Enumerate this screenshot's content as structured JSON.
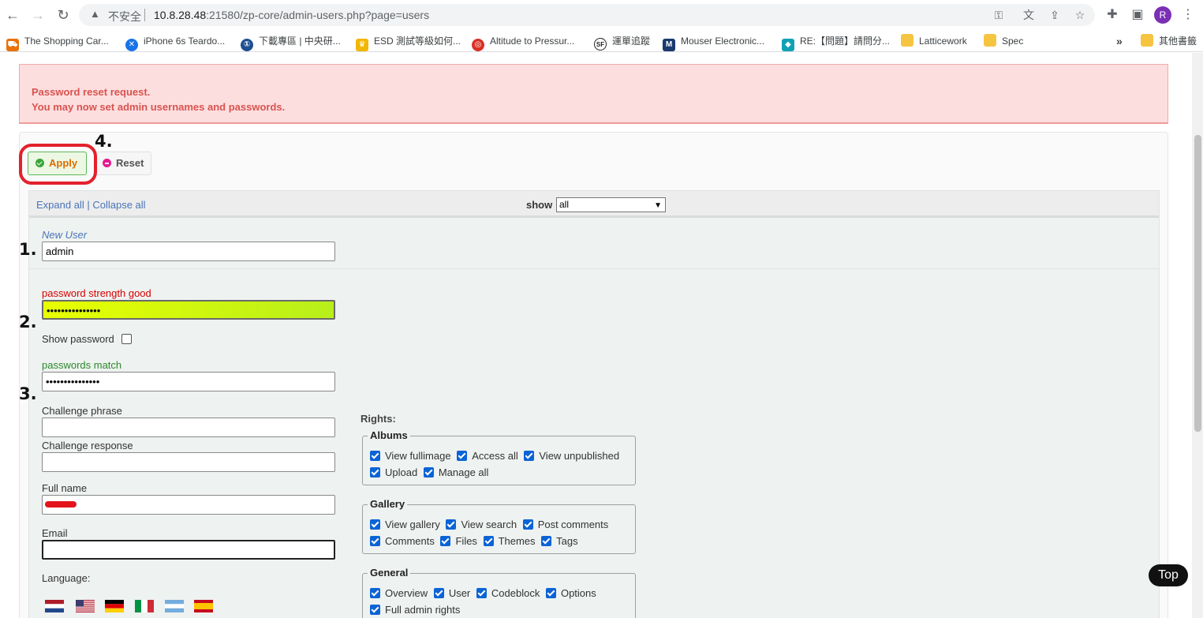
{
  "browser": {
    "insecure_label": "不安全",
    "url_host": "10.8.28.48",
    "url_rest": ":21580/zp-core/admin-users.php?page=users",
    "avatar_letter": "R",
    "bookmarks": [
      {
        "label": "The Shopping Car...",
        "icon": "cart-icon",
        "color": "#e8710a"
      },
      {
        "label": "iPhone 6s Teardo...",
        "icon": "ifixit-icon",
        "color": "#1a73e8"
      },
      {
        "label": "下載專區 | 中央研...",
        "icon": "globe-icon",
        "color": "#1d4f91"
      },
      {
        "label": "ESD 測試等級如何...",
        "icon": "trophy-icon",
        "color": "#f2b600"
      },
      {
        "label": "Altitude to Pressur...",
        "icon": "target-icon",
        "color": "#d93025"
      },
      {
        "label": "運單追蹤",
        "icon": "sf-icon",
        "color": "#222222"
      },
      {
        "label": "Mouser Electronic...",
        "icon": "mouser-icon",
        "color": "#1a3a6e"
      },
      {
        "label": "RE:【問題】請問分...",
        "icon": "bahamut-icon",
        "color": "#11a1b5"
      },
      {
        "label": "Latticework",
        "icon": "folder-icon",
        "color": "#f5c542"
      },
      {
        "label": "Spec",
        "icon": "folder-icon",
        "color": "#f5c542"
      }
    ],
    "other_bookmarks": "其他書籤",
    "overflow": "»"
  },
  "alert": {
    "line1": "Password reset request.",
    "line2": "You may now set admin usernames and passwords."
  },
  "annotations": {
    "n1": "1.",
    "n2": "2.",
    "n3": "3.",
    "n4": "4."
  },
  "actions": {
    "apply": "Apply",
    "reset": "Reset"
  },
  "header": {
    "expand": "Expand all",
    "divider": "|",
    "collapse": "Collapse all",
    "show_label": "show",
    "show_value": "all"
  },
  "form": {
    "new_user_label": "New User",
    "username": "admin",
    "strength_label": "password strength good",
    "password_mask": "•••••••••••••••",
    "show_password_label": "Show password",
    "match_label": "passwords match",
    "confirm_mask": "•••••••••••••••",
    "challenge_phrase_label": "Challenge phrase",
    "challenge_response_label": "Challenge response",
    "full_name_label": "Full name",
    "email_label": "Email",
    "language_label": "Language:"
  },
  "rights": {
    "label": "Rights:",
    "groups": [
      {
        "legend": "Albums",
        "rows": [
          [
            "View fullimage",
            "Access all",
            "View unpublished"
          ],
          [
            "Upload",
            "Manage all"
          ]
        ]
      },
      {
        "legend": "Gallery",
        "rows": [
          [
            "View gallery",
            "View search",
            "Post comments"
          ],
          [
            "Comments",
            "Files",
            "Themes",
            "Tags"
          ]
        ]
      },
      {
        "legend": "General",
        "rows": [
          [
            "Overview",
            "User",
            "Codeblock",
            "Options"
          ],
          [
            "Full admin rights"
          ]
        ]
      }
    ]
  },
  "top_button": "Top"
}
